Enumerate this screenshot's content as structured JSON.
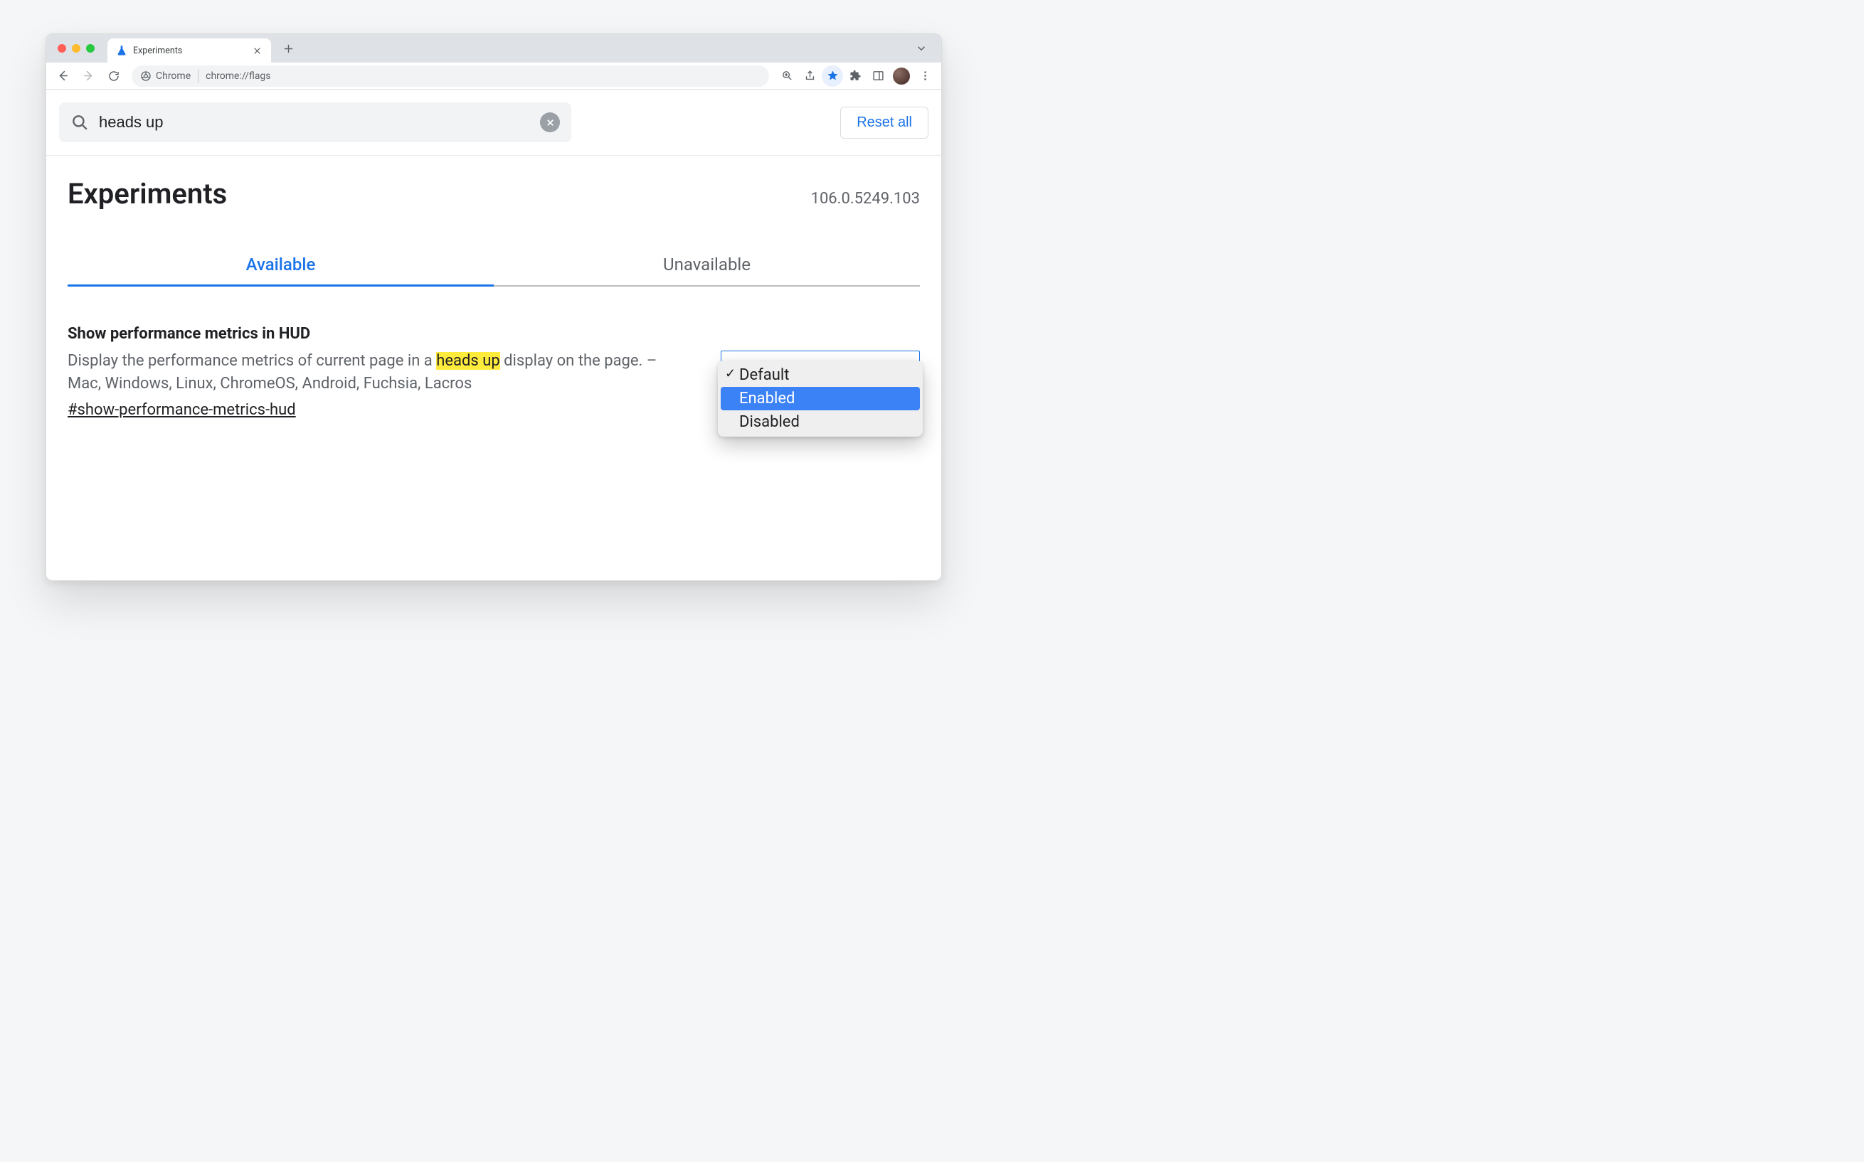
{
  "browser": {
    "tab_title": "Experiments",
    "omnibox_chip": "Chrome",
    "url": "chrome://flags"
  },
  "search": {
    "value": "heads up",
    "reset_label": "Reset all"
  },
  "page": {
    "title": "Experiments",
    "version": "106.0.5249.103"
  },
  "tabs": {
    "available": "Available",
    "unavailable": "Unavailable"
  },
  "flag": {
    "title": "Show performance metrics in HUD",
    "desc_pre": "Display the performance metrics of current page in a ",
    "desc_hl": "heads up",
    "desc_post": " display on the page. – Mac, Windows, Linux, ChromeOS, Android, Fuchsia, Lacros",
    "hash": "#show-performance-metrics-hud"
  },
  "dropdown": {
    "options": {
      "default": "Default",
      "enabled": "Enabled",
      "disabled": "Disabled"
    }
  }
}
